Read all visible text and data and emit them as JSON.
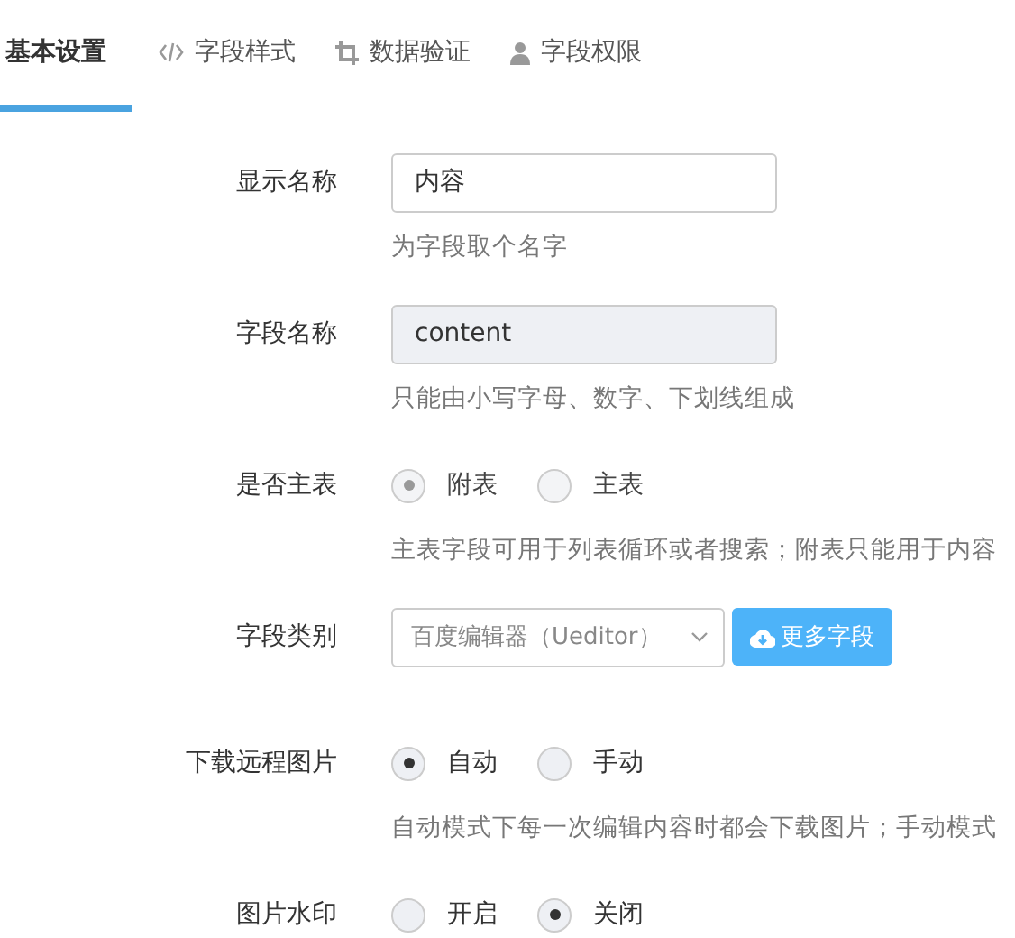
{
  "tabs": [
    {
      "label": "基本设置",
      "kind": "plain",
      "selected": true
    },
    {
      "label": "字段样式",
      "kind": "code",
      "selected": false
    },
    {
      "label": "数据验证",
      "kind": "crop",
      "selected": false
    },
    {
      "label": "字段权限",
      "kind": "user",
      "selected": false
    }
  ],
  "fields": [
    {
      "kind": "text",
      "label": "显示名称",
      "value": "内容",
      "readonly": false,
      "hint": "为字段取个名字"
    },
    {
      "kind": "text",
      "label": "字段名称",
      "value": "content",
      "readonly": true,
      "hint": "只能由小写字母、数字、下划线组成"
    },
    {
      "kind": "radio",
      "label": "是否主表",
      "disabled": true,
      "options": [
        {
          "label": "附表",
          "selected": true
        },
        {
          "label": "主表",
          "selected": false
        }
      ],
      "hint": "主表字段可用于列表循环或者搜索；附表只能用于内容"
    },
    {
      "kind": "select",
      "label": "字段类别",
      "value": "百度编辑器（Ueditor）",
      "button": "更多字段"
    },
    {
      "kind": "radio",
      "label": "下载远程图片",
      "disabled": false,
      "options": [
        {
          "label": "自动",
          "selected": true
        },
        {
          "label": "手动",
          "selected": false
        }
      ],
      "hint": "自动模式下每一次编辑内容时都会下载图片；手动模式"
    },
    {
      "kind": "radio",
      "label": "图片水印",
      "disabled": false,
      "options": [
        {
          "label": "开启",
          "selected": false
        },
        {
          "label": "关闭",
          "selected": true
        }
      ]
    }
  ]
}
